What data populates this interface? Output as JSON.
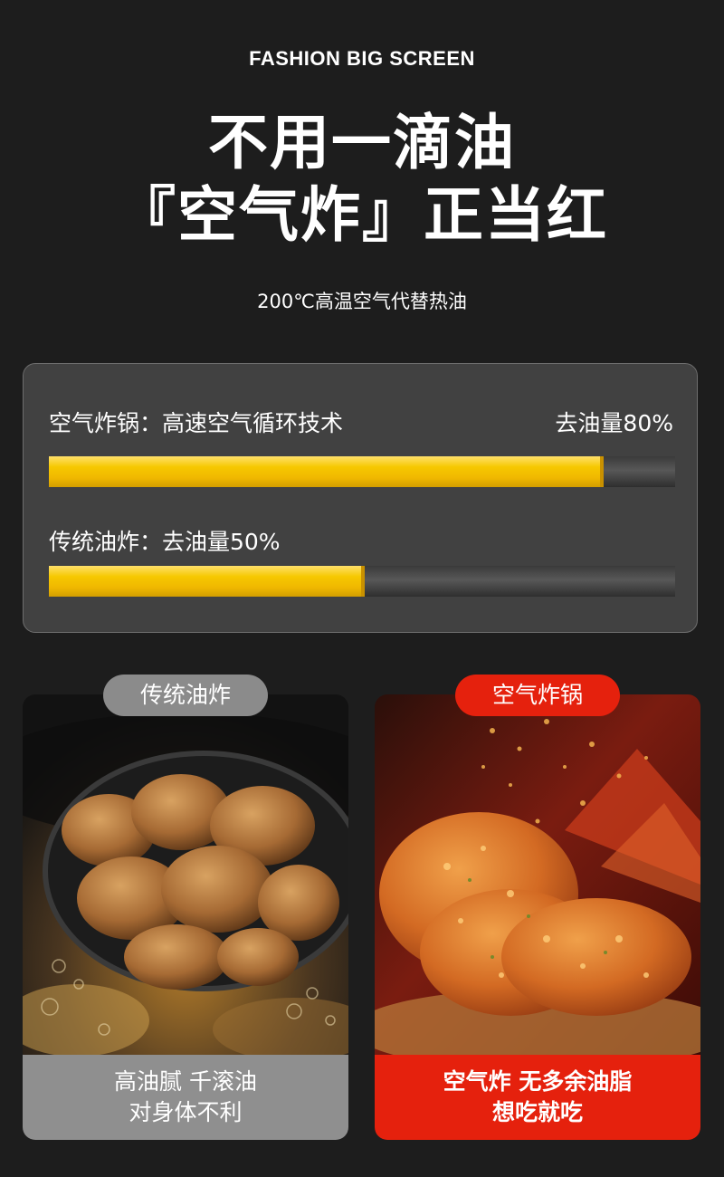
{
  "header": {
    "eyebrow": "FASHION BIG SCREEN",
    "headline_line1": "不用一滴油",
    "headline_line2": "『空气炸』正当红",
    "subheadline": "200℃高温空气代替热油"
  },
  "comparison": {
    "air_fryer": {
      "label": "空气炸锅：高速空气循环技术",
      "value_text": "去油量80%",
      "oil_removal": 0.8
    },
    "traditional": {
      "label": "传统油炸：去油量50%",
      "oil_removal": 0.5
    }
  },
  "cards": {
    "left": {
      "tag": "传统油炸",
      "caption_line1": "高油腻  千滚油",
      "caption_line2": "对身体不利"
    },
    "right": {
      "tag": "空气炸锅",
      "caption_line1": "空气炸  无多余油脂",
      "caption_line2": "想吃就吃"
    }
  },
  "colors": {
    "background": "#1d1d1d",
    "panel": "#414141",
    "bar_fill": "#f6c800",
    "accent_red": "#e5210d",
    "tag_gray": "#8b8b8b"
  }
}
